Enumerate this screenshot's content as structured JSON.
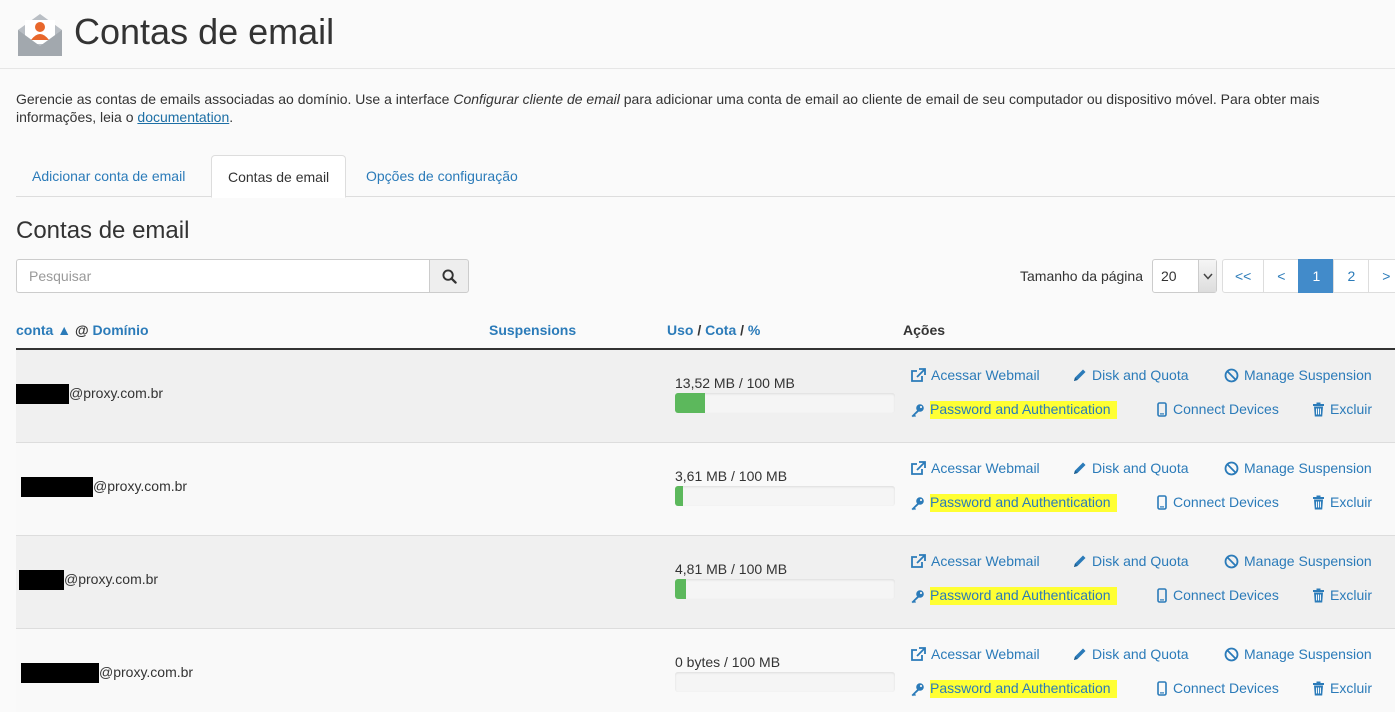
{
  "header": {
    "title": "Contas de email",
    "icon": "email-accounts-icon"
  },
  "intro": {
    "part1": "Gerencie as contas de emails associadas ao domínio. Use a interface ",
    "emphasis": "Configurar cliente de email",
    "part2": " para adicionar uma conta de email ao cliente de email de seu computador ou dispositivo móvel. Para obter mais informações, leia o ",
    "link": "documentation",
    "part3": "."
  },
  "tabs": [
    {
      "label": "Adicionar conta de email",
      "active": false
    },
    {
      "label": "Contas de email",
      "active": true
    },
    {
      "label": "Opções de configuração",
      "active": false
    }
  ],
  "section_title": "Contas de email",
  "search": {
    "placeholder": "Pesquisar",
    "icon": "search-icon"
  },
  "page_size": {
    "label": "Tamanho da página",
    "value": "20"
  },
  "pagination": {
    "first": "<<",
    "prev": "<",
    "pages": [
      "1",
      "2"
    ],
    "current": "1",
    "next": ">"
  },
  "table": {
    "headers": {
      "account": "conta",
      "sort_indicator": "▲",
      "at": "@",
      "domain": "Domínio",
      "suspensions": "Suspensions",
      "usage": "Uso",
      "sep1": "/",
      "quota": "Cota",
      "sep2": "/",
      "percent": "%",
      "actions": "Ações"
    },
    "rows": [
      {
        "domain": "@proxy.com.br",
        "usage": "13,52 MB / 100 MB",
        "fill_percent": 13.52
      },
      {
        "domain": "@proxy.com.br",
        "usage": "3,61 MB / 100 MB",
        "fill_percent": 3.61
      },
      {
        "domain": "@proxy.com.br",
        "usage": "4,81 MB / 100 MB",
        "fill_percent": 4.81
      },
      {
        "domain": "@proxy.com.br",
        "usage": "0 bytes / 100 MB",
        "fill_percent": 0
      }
    ],
    "actions": {
      "webmail": "Acessar Webmail",
      "disk": "Disk and Quota",
      "suspension": "Manage Suspension",
      "password": "Password and Authentication",
      "devices": "Connect Devices",
      "delete": "Excluir"
    }
  },
  "colors": {
    "link": "#2b7bb9",
    "progress": "#5cb85c",
    "highlight": "#ffff33",
    "pager_active": "#428bca"
  }
}
